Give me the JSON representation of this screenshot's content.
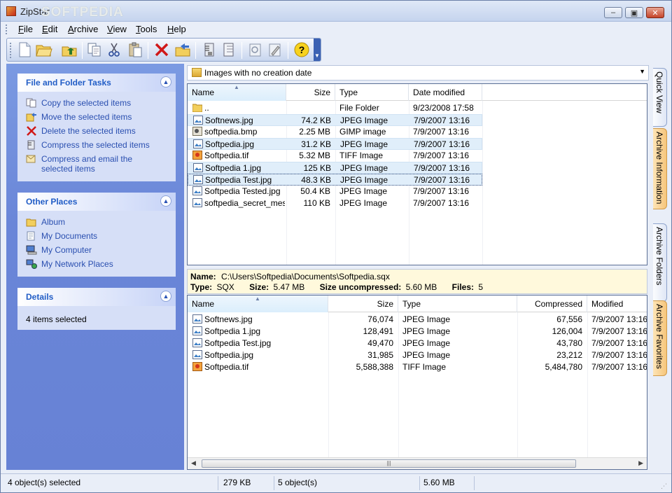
{
  "window": {
    "title": "ZipStar",
    "watermark": "SOFTPEDIA"
  },
  "menu": [
    {
      "label": "File",
      "u": "F",
      "rest": "ile"
    },
    {
      "label": "Edit",
      "u": "E",
      "rest": "dit"
    },
    {
      "label": "Archive",
      "u": "A",
      "rest": "rchive"
    },
    {
      "label": "View",
      "u": "V",
      "rest": "iew"
    },
    {
      "label": "Tools",
      "u": "T",
      "rest": "ools"
    },
    {
      "label": "Help",
      "u": "H",
      "rest": "elp"
    }
  ],
  "toolbar": {
    "buttons": [
      "new-archive-icon",
      "open-folder-icon",
      "up-folder-icon",
      "copy-icon",
      "cut-icon",
      "paste-icon",
      "delete-icon",
      "move-icon",
      "compress-icon",
      "extract-icon",
      "view-icon",
      "properties-icon",
      "help-icon"
    ]
  },
  "panels": {
    "tasks": {
      "title": "File and Folder Tasks",
      "items": [
        "Copy the selected items",
        "Move the selected items",
        "Delete the selected items",
        "Compress the selected items",
        "Compress and email the selected items"
      ]
    },
    "places": {
      "title": "Other Places",
      "items": [
        "Album",
        "My Documents",
        "My Computer",
        "My Network Places"
      ]
    },
    "details": {
      "title": "Details",
      "text": "4 items selected"
    }
  },
  "address": {
    "text": "Images with no creation date"
  },
  "files": {
    "headers": {
      "name": "Name",
      "size": "Size",
      "type": "Type",
      "date": "Date modified"
    },
    "rows": [
      {
        "name": "..",
        "size": "",
        "type": "File Folder",
        "date": "9/23/2008 17:58",
        "icon": "folder-icon",
        "state": ""
      },
      {
        "name": "Softnews.jpg",
        "size": "74.2 KB",
        "type": "JPEG Image",
        "date": "7/9/2007 13:16",
        "icon": "jpeg-file-icon",
        "state": "sel"
      },
      {
        "name": "softpedia.bmp",
        "size": "2.25 MB",
        "type": "GIMP image",
        "date": "7/9/2007 13:16",
        "icon": "bmp-file-icon",
        "state": ""
      },
      {
        "name": "Softpedia.jpg",
        "size": "31.2 KB",
        "type": "JPEG Image",
        "date": "7/9/2007 13:16",
        "icon": "jpeg-file-icon",
        "state": "sel"
      },
      {
        "name": "Softpedia.tif",
        "size": "5.32 MB",
        "type": "TIFF Image",
        "date": "7/9/2007 13:16",
        "icon": "tiff-file-icon",
        "state": ""
      },
      {
        "name": "Softpedia 1.jpg",
        "size": "125 KB",
        "type": "JPEG Image",
        "date": "7/9/2007 13:16",
        "icon": "jpeg-file-icon",
        "state": "sel"
      },
      {
        "name": "Softpedia Test.jpg",
        "size": "48.3 KB",
        "type": "JPEG Image",
        "date": "7/9/2007 13:16",
        "icon": "jpeg-file-icon",
        "state": "focus"
      },
      {
        "name": "Softpedia Tested.jpg",
        "size": "50.4 KB",
        "type": "JPEG Image",
        "date": "7/9/2007 13:16",
        "icon": "jpeg-file-icon",
        "state": ""
      },
      {
        "name": "softpedia_secret_mes...",
        "size": "110 KB",
        "type": "JPEG Image",
        "date": "7/9/2007 13:16",
        "icon": "jpeg-file-icon",
        "state": ""
      }
    ]
  },
  "archive_info": {
    "name_label": "Name:",
    "name": "C:\\Users\\Softpedia\\Documents\\Softpedia.sqx",
    "type_label": "Type:",
    "type": "SQX",
    "size_label": "Size:",
    "size": "5.47 MB",
    "uncomp_label": "Size uncompressed:",
    "uncomp": "5.60 MB",
    "files_label": "Files:",
    "files": "5"
  },
  "archive": {
    "headers": {
      "name": "Name",
      "size": "Size",
      "type": "Type",
      "compressed": "Compressed",
      "modified": "Modified"
    },
    "rows": [
      {
        "name": "Softnews.jpg",
        "size": "76,074",
        "type": "JPEG Image",
        "compressed": "67,556",
        "modified": "7/9/2007  13:16",
        "icon": "jpeg-file-icon"
      },
      {
        "name": "Softpedia 1.jpg",
        "size": "128,491",
        "type": "JPEG Image",
        "compressed": "126,004",
        "modified": "7/9/2007  13:16",
        "icon": "jpeg-file-icon"
      },
      {
        "name": "Softpedia Test.jpg",
        "size": "49,470",
        "type": "JPEG Image",
        "compressed": "43,780",
        "modified": "7/9/2007  13:16",
        "icon": "jpeg-file-icon"
      },
      {
        "name": "Softpedia.jpg",
        "size": "31,985",
        "type": "JPEG Image",
        "compressed": "23,212",
        "modified": "7/9/2007  13:16",
        "icon": "jpeg-file-icon"
      },
      {
        "name": "Softpedia.tif",
        "size": "5,588,388",
        "type": "TIFF Image",
        "compressed": "5,484,780",
        "modified": "7/9/2007  13:16",
        "icon": "tiff-file-icon"
      }
    ],
    "scroll_grip": "|||"
  },
  "side_tabs": [
    "Quick View",
    "Archive Information",
    "Archive Folders",
    "Archive Favorites"
  ],
  "status": {
    "selected": "4 object(s) selected",
    "size": "279 KB",
    "count": "5 object(s)",
    "total": "5.60 MB"
  },
  "colors": {
    "accent": "#215dc6",
    "selection": "#e0eefa",
    "task_pane": "#6a86d8"
  }
}
